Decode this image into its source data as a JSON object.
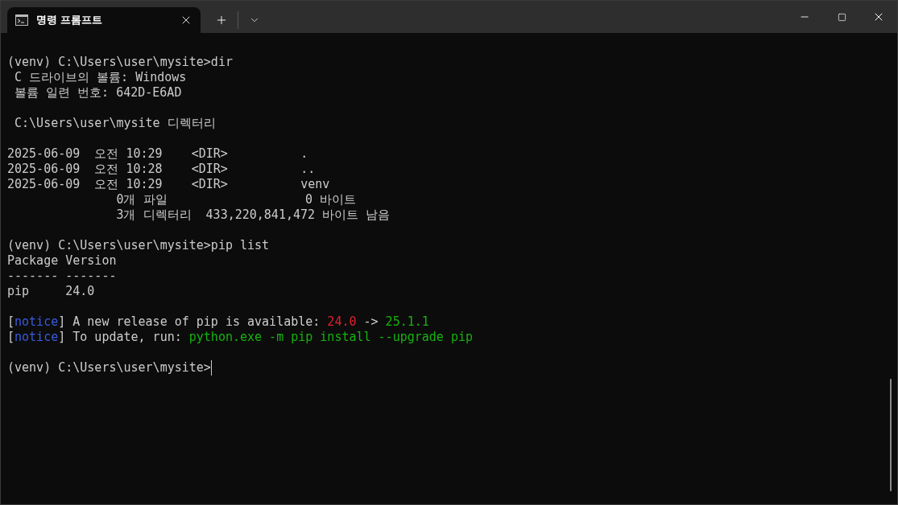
{
  "window": {
    "tab_title": "명령 프롬프트"
  },
  "terminal": {
    "blocks": [
      [
        {
          "segments": [
            {
              "text": "(venv) C:\\Users\\user\\mysite>dir"
            }
          ]
        },
        {
          "segments": [
            {
              "text": " C 드라이브의 볼륨: Windows"
            }
          ]
        },
        {
          "segments": [
            {
              "text": " 볼륨 일련 번호: 642D-E6AD"
            }
          ]
        }
      ],
      [
        {
          "segments": [
            {
              "text": " C:\\Users\\user\\mysite 디렉터리"
            }
          ]
        }
      ],
      [
        {
          "segments": [
            {
              "text": "2025-06-09  오전 10:29    <DIR>          ."
            }
          ]
        },
        {
          "segments": [
            {
              "text": "2025-06-09  오전 10:28    <DIR>          .."
            }
          ]
        },
        {
          "segments": [
            {
              "text": "2025-06-09  오전 10:29    <DIR>          venv"
            }
          ]
        },
        {
          "segments": [
            {
              "text": "               0개 파일                   0 바이트"
            }
          ]
        },
        {
          "segments": [
            {
              "text": "               3개 디렉터리  433,220,841,472 바이트 남음"
            }
          ]
        }
      ],
      [
        {
          "segments": [
            {
              "text": "(venv) C:\\Users\\user\\mysite>pip list"
            }
          ]
        },
        {
          "segments": [
            {
              "text": "Package Version"
            }
          ]
        },
        {
          "segments": [
            {
              "text": "------- -------"
            }
          ]
        },
        {
          "segments": [
            {
              "text": "pip     24.0"
            }
          ]
        }
      ],
      [
        {
          "segments": [
            {
              "text": "["
            },
            {
              "text": "notice",
              "color": "#3b5bdb"
            },
            {
              "text": "] A new release of pip is available: "
            },
            {
              "text": "24.0",
              "color": "#e0202e"
            },
            {
              "text": " -> "
            },
            {
              "text": "25.1.1",
              "color": "#16b30e"
            }
          ]
        },
        {
          "segments": [
            {
              "text": "["
            },
            {
              "text": "notice",
              "color": "#3b5bdb"
            },
            {
              "text": "] To update, run: "
            },
            {
              "text": "python.exe -m pip install --upgrade pip",
              "color": "#16b30e"
            }
          ]
        }
      ],
      [
        {
          "segments": [
            {
              "text": "(venv) C:\\Users\\user\\mysite>"
            }
          ],
          "cursor": true
        }
      ]
    ]
  }
}
